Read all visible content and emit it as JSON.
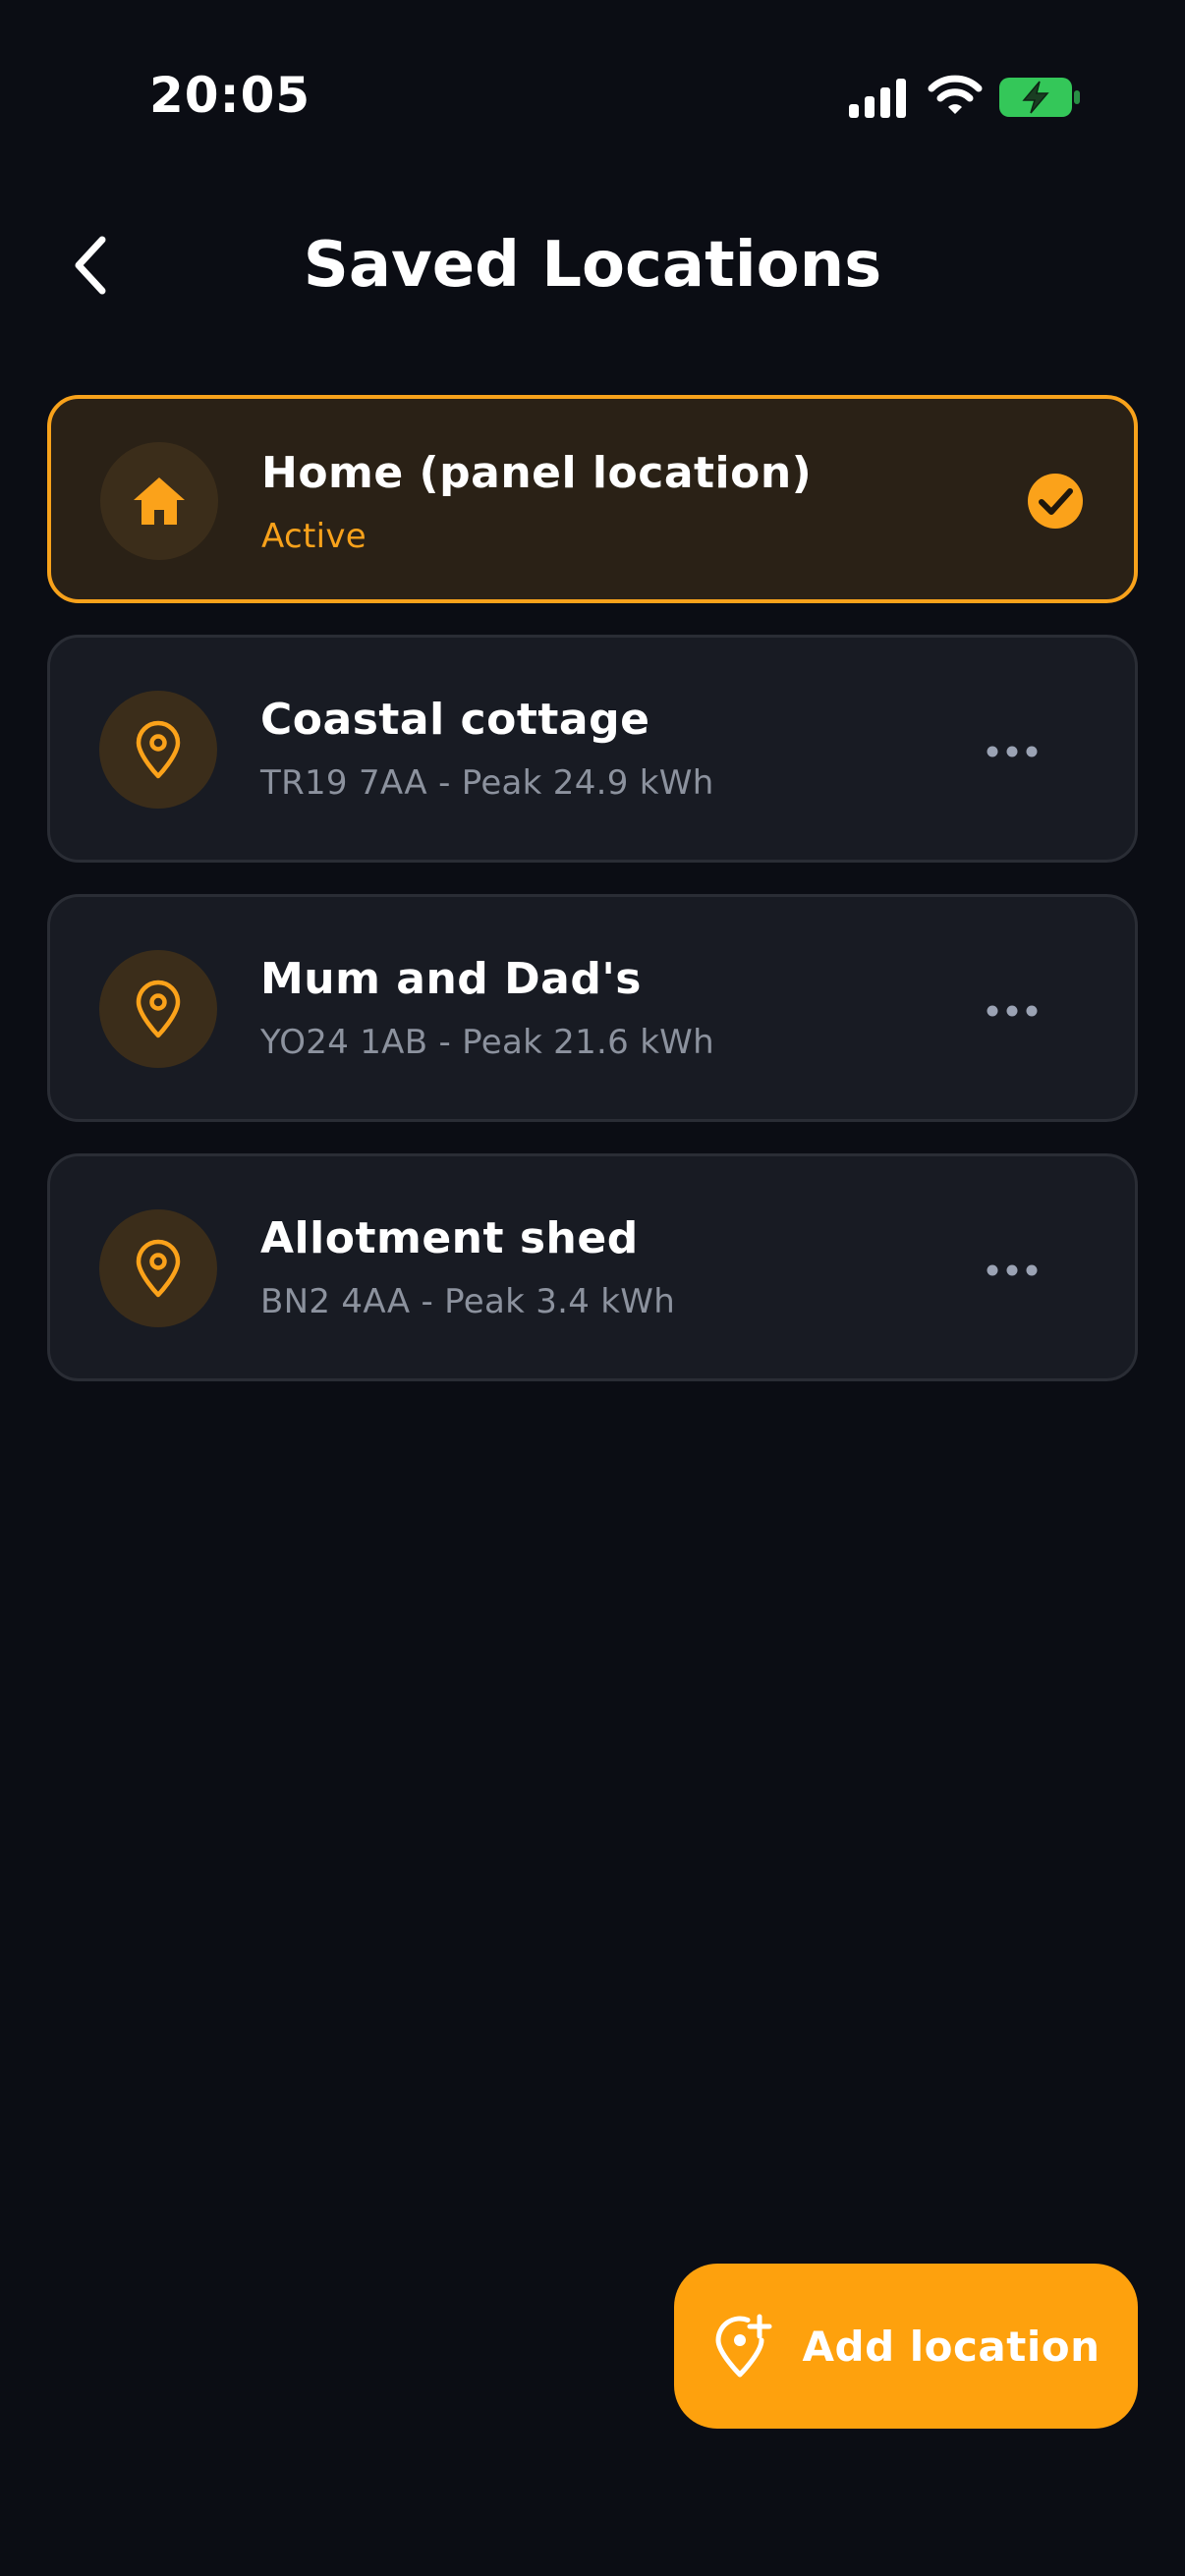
{
  "status_bar": {
    "time": "20:05"
  },
  "header": {
    "title": "Saved Locations"
  },
  "locations": [
    {
      "title": "Home (panel location)",
      "subtitle": "Active",
      "icon": "home-icon",
      "active": true
    },
    {
      "title": "Coastal cottage",
      "subtitle": "TR19 7AA - Peak 24.9 kWh",
      "icon": "location-pin-icon",
      "active": false
    },
    {
      "title": "Mum and Dad's",
      "subtitle": "YO24 1AB - Peak 21.6 kWh",
      "icon": "location-pin-icon",
      "active": false
    },
    {
      "title": "Allotment shed",
      "subtitle": "BN2 4AA - Peak 3.4 kWh",
      "icon": "location-pin-icon",
      "active": false
    }
  ],
  "add_button": {
    "label": "Add location",
    "icon": "add-location-icon"
  },
  "colors": {
    "background": "#0b0d14",
    "accent": "#f8a21b",
    "card": "#181b23",
    "active_card": "#2a2116",
    "battery": "#34c759"
  }
}
